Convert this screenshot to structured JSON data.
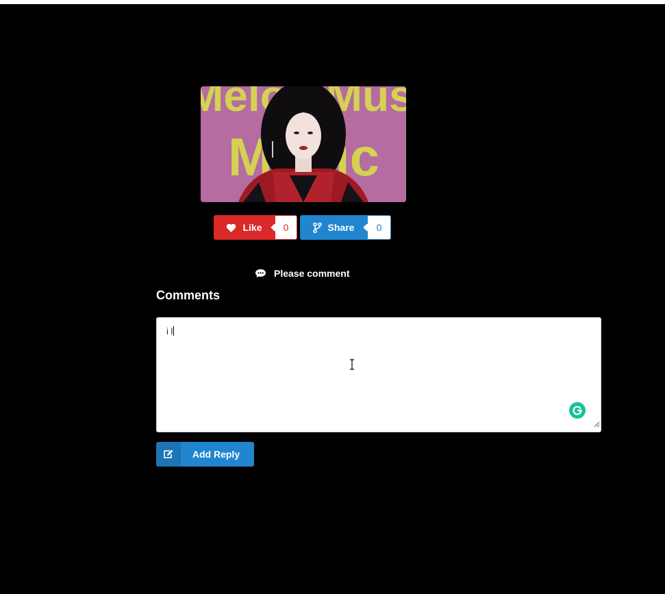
{
  "media": {
    "image_alt": "Photo of a woman with long dark hair in a red plaid jacket in front of a pink backdrop with yellow lettering",
    "backdrop_text": "Melon Music"
  },
  "actions": {
    "like": {
      "label": "Like",
      "count": "0",
      "icon": "heart-icon",
      "color": "#db2828"
    },
    "share": {
      "label": "Share",
      "count": "0",
      "icon": "fork-icon",
      "color": "#2185d0"
    }
  },
  "prompt": {
    "label": "Please comment",
    "icon": "comment-bubble-icon"
  },
  "comments": {
    "title": "Comments",
    "reply_value": "i l",
    "add_reply_label": "Add Reply",
    "add_reply_icon": "edit-icon",
    "grammarly_icon": "grammarly-icon"
  }
}
